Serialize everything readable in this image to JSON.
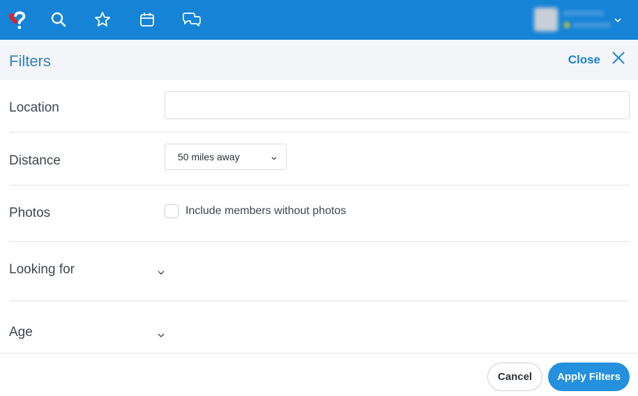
{
  "topbar": {
    "brand_color": "#1684d6",
    "icons": [
      "logo-heart-question-icon",
      "search-icon",
      "star-icon",
      "calendar-icon",
      "chat-icon"
    ],
    "user": {
      "name": "[blurred]",
      "status": "[blurred]"
    }
  },
  "filters": {
    "title": "Filters",
    "close_label": "Close"
  },
  "rows": {
    "location": {
      "label": "Location",
      "value": "",
      "placeholder": ""
    },
    "distance": {
      "label": "Distance",
      "selected": "50 miles away"
    },
    "photos": {
      "label": "Photos",
      "checkbox_label": "Include members without photos",
      "checked": false
    },
    "looking_for": {
      "label": "Looking for",
      "expanded": false
    },
    "age": {
      "label": "Age",
      "expanded": false
    }
  },
  "footer": {
    "cancel_label": "Cancel",
    "apply_label": "Apply Filters",
    "accent": "#2590de"
  }
}
